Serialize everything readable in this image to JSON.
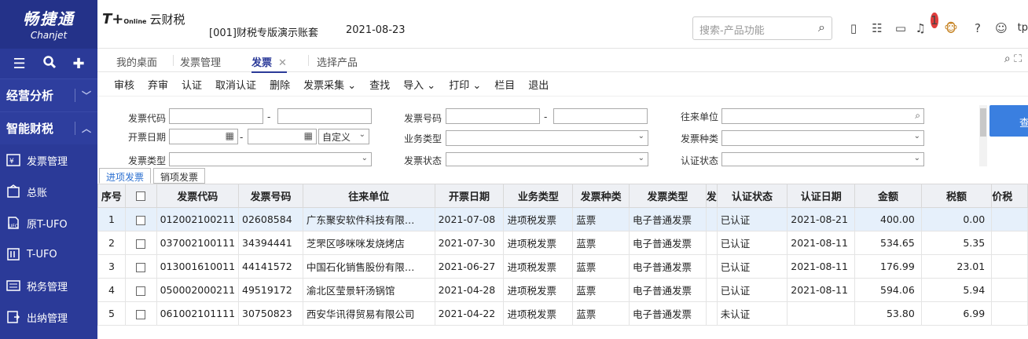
{
  "sidebar": {
    "logo_cn": "畅捷通",
    "logo_en": "Chanjet",
    "sections": [
      {
        "label": "经营分析"
      },
      {
        "label": "智能财税"
      }
    ],
    "items": [
      {
        "label": "发票管理",
        "icon": "invoice-icon"
      },
      {
        "label": "总账",
        "icon": "ledger-icon"
      },
      {
        "label": "原T-UFO",
        "icon": "ufo-icon"
      },
      {
        "label": "T-UFO",
        "icon": "report-icon"
      },
      {
        "label": "税务管理",
        "icon": "tax-icon"
      },
      {
        "label": "出纳管理",
        "icon": "cashier-icon"
      }
    ]
  },
  "header": {
    "brand": "T+",
    "brand_sub": "Online",
    "product": "云财税",
    "account": "[001]财税专版演示账套",
    "date": "2021-08-23",
    "search_placeholder": "搜索-产品功能",
    "notification_count": "1",
    "user": "tp"
  },
  "tabs": {
    "items": [
      {
        "label": "我的桌面"
      },
      {
        "label": "发票管理"
      },
      {
        "label": "发票"
      },
      {
        "label": "选择产品"
      }
    ],
    "close": "✕"
  },
  "toolbar": {
    "items": [
      "审核",
      "弃审",
      "认证",
      "取消认证",
      "删除",
      "发票采集",
      "查找",
      "导入",
      "打印",
      "栏目",
      "退出"
    ]
  },
  "filters": {
    "invoice_code": "发票代码",
    "invoice_no": "发票号码",
    "counterparty": "往来单位",
    "issue_date": "开票日期",
    "biz_type": "业务类型",
    "invoice_kind": "发票种类",
    "invoice_type": "发票类型",
    "invoice_status": "发票状态",
    "cert_status": "认证状态",
    "date_mode": "自定义",
    "dash": "-",
    "query_button": "查"
  },
  "subtabs": [
    "进项发票",
    "销项发票"
  ],
  "table": {
    "headers": [
      "序号",
      "",
      "发票代码",
      "发票号码",
      "往来单位",
      "开票日期",
      "业务类型",
      "发票种类",
      "发票类型",
      "发",
      "认证状态",
      "认证日期",
      "金额",
      "税额",
      "价税"
    ],
    "rows": [
      [
        "1",
        "",
        "012002100211",
        "02608584",
        "广东聚安软件科技有限…",
        "2021-07-08",
        "进项税发票",
        "蓝票",
        "电子普通发票",
        "",
        "已认证",
        "2021-08-21",
        "400.00",
        "0.00",
        ""
      ],
      [
        "2",
        "",
        "037002100111",
        "34394441",
        "芝罘区哆咪咪发烧烤店",
        "2021-07-30",
        "进项税发票",
        "蓝票",
        "电子普通发票",
        "",
        "已认证",
        "2021-08-11",
        "534.65",
        "5.35",
        ""
      ],
      [
        "3",
        "",
        "013001610011",
        "44141572",
        "中国石化销售股份有限…",
        "2021-06-27",
        "进项税发票",
        "蓝票",
        "电子普通发票",
        "",
        "已认证",
        "2021-08-11",
        "176.99",
        "23.01",
        ""
      ],
      [
        "4",
        "",
        "050002000211",
        "49519172",
        "渝北区莹景轩汤锅馆",
        "2021-04-28",
        "进项税发票",
        "蓝票",
        "电子普通发票",
        "",
        "已认证",
        "2021-08-11",
        "594.06",
        "5.94",
        ""
      ],
      [
        "5",
        "",
        "061002101111",
        "30750823",
        "西安华讯得贸易有限公司",
        "2021-04-22",
        "进项税发票",
        "蓝票",
        "电子普通发票",
        "",
        "未认证",
        "",
        "53.80",
        "6.99",
        ""
      ]
    ]
  },
  "colors": {
    "sidebar": "#2b3a98",
    "accent": "#3a7fe0",
    "selected_row": "#e6f0fb"
  }
}
